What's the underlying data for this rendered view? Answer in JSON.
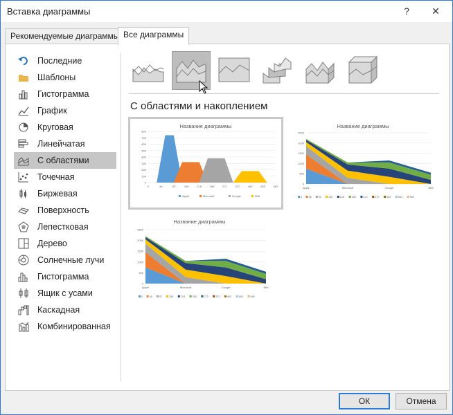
{
  "window": {
    "title": "Вставка диаграммы",
    "help_glyph": "?",
    "close_glyph": "✕"
  },
  "tabs": [
    {
      "label": "Рекомендуемые диаграммы",
      "active": false
    },
    {
      "label": "Все диаграммы",
      "active": true
    }
  ],
  "sidebar": {
    "items": [
      {
        "label": "Последние",
        "icon": "undo-arrow-icon"
      },
      {
        "label": "Шаблоны",
        "icon": "folder-icon"
      },
      {
        "label": "Гистограмма",
        "icon": "column-chart-icon"
      },
      {
        "label": "График",
        "icon": "line-chart-icon"
      },
      {
        "label": "Круговая",
        "icon": "pie-chart-icon"
      },
      {
        "label": "Линейчатая",
        "icon": "bar-chart-icon"
      },
      {
        "label": "С областями",
        "icon": "area-chart-icon",
        "selected": true
      },
      {
        "label": "Точечная",
        "icon": "scatter-chart-icon"
      },
      {
        "label": "Биржевая",
        "icon": "stock-chart-icon"
      },
      {
        "label": "Поверхность",
        "icon": "surface-chart-icon"
      },
      {
        "label": "Лепестковая",
        "icon": "radar-chart-icon"
      },
      {
        "label": "Дерево",
        "icon": "treemap-icon"
      },
      {
        "label": "Солнечные лучи",
        "icon": "sunburst-icon"
      },
      {
        "label": "Гистограмма",
        "icon": "histogram-icon"
      },
      {
        "label": "Ящик с усами",
        "icon": "box-whisker-icon"
      },
      {
        "label": "Каскадная",
        "icon": "waterfall-icon"
      },
      {
        "label": "Комбинированная",
        "icon": "combo-chart-icon"
      }
    ]
  },
  "subtypes": {
    "selected_index": 1,
    "items": [
      "area-icon",
      "stacked-area-icon",
      "percent-stacked-area-icon",
      "area-3d-icon",
      "stacked-area-3d-icon",
      "percent-stacked-area-3d-icon"
    ]
  },
  "section_title": "С областями и накоплением",
  "colors": {
    "accent": "#2b79d8",
    "blue": "#5b9bd5",
    "orange": "#ed7d31",
    "gray": "#a5a5a5",
    "yellow": "#ffc000",
    "darkblue": "#264478",
    "green": "#70ad47",
    "navy": "#255e91",
    "brown": "#9e480e",
    "olive": "#997300",
    "lightblue": "#9dc3e6",
    "peach": "#f4b183"
  },
  "chart_data": [
    {
      "type": "area",
      "title": "Название диаграммы",
      "x": [
        "0",
        "46",
        "92",
        "138",
        "184",
        "230",
        "276",
        "322",
        "368",
        "414",
        "460",
        "506",
        "552",
        "598",
        "644",
        "690"
      ],
      "x_tick_labels": [
        "0",
        "46",
        "92",
        "155",
        "218",
        "265",
        "272",
        "372",
        "462",
        "653",
        "662"
      ],
      "y_tick_labels": [
        "0",
        "100",
        "200",
        "300",
        "400",
        "500",
        "600",
        "700",
        "800"
      ],
      "ylim": [
        0,
        800
      ],
      "series": [
        {
          "name": "Apple",
          "values": [
            0,
            0,
            740,
            740,
            0,
            0,
            0,
            0,
            0,
            0,
            0,
            0,
            0,
            0,
            0,
            0
          ]
        },
        {
          "name": "Microsoft",
          "values": [
            0,
            0,
            0,
            0,
            320,
            320,
            320,
            0,
            0,
            0,
            0,
            0,
            0,
            0,
            0,
            0
          ]
        },
        {
          "name": "Google",
          "values": [
            0,
            0,
            0,
            0,
            0,
            0,
            0,
            380,
            380,
            380,
            0,
            0,
            0,
            0,
            0,
            0
          ]
        },
        {
          "name": "IBM",
          "values": [
            0,
            0,
            0,
            0,
            0,
            0,
            0,
            0,
            0,
            0,
            0,
            180,
            180,
            180,
            0,
            0
          ]
        }
      ],
      "legend": [
        "Apple",
        "Microsoft",
        "Google",
        "IBM"
      ],
      "legend_position": "bottom"
    },
    {
      "type": "area",
      "title": "Название диаграммы",
      "categories": [
        "Apple",
        "Microsoft",
        "Google",
        "IBM"
      ],
      "y_tick_labels": [
        "0",
        "500",
        "1000",
        "1500",
        "2000",
        "2500"
      ],
      "ylim": [
        0,
        2500
      ],
      "legend": [
        "0",
        "46",
        "92",
        "155",
        "218",
        "265",
        "272",
        "372",
        "462",
        "653",
        "662"
      ],
      "legend_position": "bottom"
    },
    {
      "type": "area",
      "title": "Название диаграммы",
      "categories": [
        "Apple",
        "Microsoft",
        "Google",
        "IBM"
      ],
      "y_tick_labels": [
        "0",
        "500",
        "1000",
        "1500",
        "2000",
        "2500"
      ],
      "ylim": [
        0,
        2500
      ],
      "legend": [
        "0",
        "46",
        "92",
        "155",
        "218",
        "265",
        "272",
        "372",
        "462",
        "653",
        "662"
      ],
      "legend_position": "bottom"
    }
  ],
  "footer": {
    "ok_label": "ОК",
    "cancel_label": "Отмена"
  }
}
